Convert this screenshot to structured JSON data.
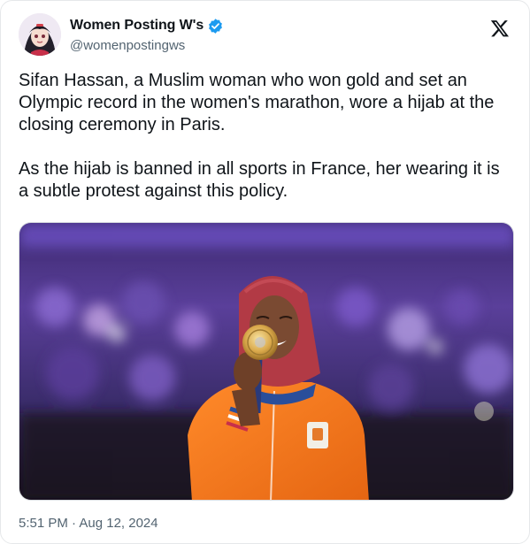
{
  "tweet": {
    "display_name": "Women Posting W's",
    "handle": "@womenpostingws",
    "verified": true,
    "platform_icon": "x-logo-icon",
    "text": "Sifan Hassan, a Muslim woman who won gold and set an Olympic record in the women's marathon, wore a hijab at the closing ceremony in Paris.\n\nAs the hijab is banned in all sports in France, her wearing it is a subtle protest against this policy.",
    "timestamp": "5:51 PM · Aug 12, 2024"
  },
  "colors": {
    "verified_blue": "#1d9bf0",
    "handle_gray": "#536471",
    "jacket_orange": "#f47a20",
    "hijab_red": "#b23a45",
    "medal_gold": "#d9a84a",
    "background_purple": "#5a3a9a"
  }
}
